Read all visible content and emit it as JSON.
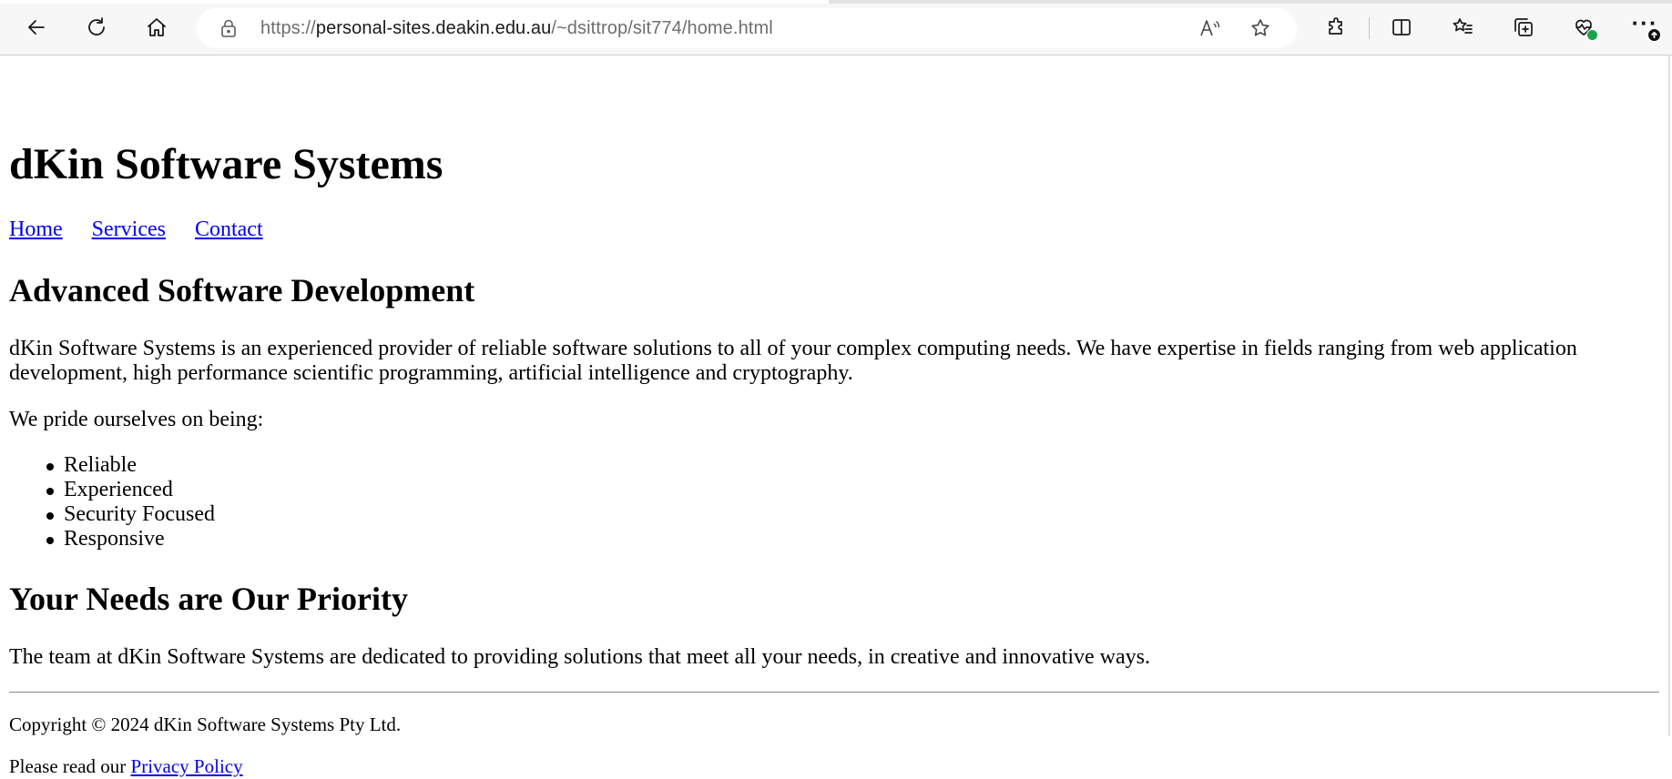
{
  "browser": {
    "url_prefix": "https://",
    "url_host": "personal-sites.deakin.edu.au",
    "url_path": "/~dsittrop/sit774/home.html",
    "read_aloud_label": "A"
  },
  "page": {
    "site_title": "dKin Software Systems",
    "nav": [
      "Home",
      "Services",
      "Contact"
    ],
    "section1_heading": "Advanced Software Development",
    "section1_paragraph": "dKin Software Systems is an experienced provider of reliable software solutions to all of your complex computing needs. We have expertise in fields ranging from web application development, high performance scientific programming, artificial intelligence and cryptography.",
    "pride_intro": "We pride ourselves on being:",
    "qualities": [
      "Reliable",
      "Experienced",
      "Security Focused",
      "Responsive"
    ],
    "section2_heading": "Your Needs are Our Priority",
    "section2_paragraph": "The team at dKin Software Systems are dedicated to providing solutions that meet all your needs, in creative and innovative ways."
  },
  "footer": {
    "copyright": "Copyright © 2024 dKin Software Systems Pty Ltd.",
    "privacy_prefix": "Please read our ",
    "privacy_link": "Privacy Policy"
  }
}
